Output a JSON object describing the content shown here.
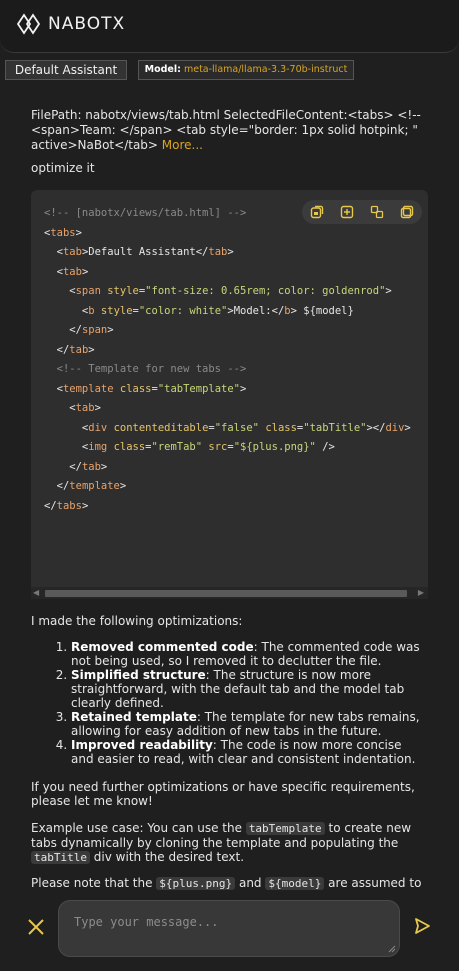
{
  "header": {
    "logo_text": "NABOTX"
  },
  "tabs": {
    "default_label": "Default Assistant",
    "model_label": "Model:",
    "model_value": "meta-llama/llama-3.3-70b-instruct"
  },
  "chat": {
    "user_message": "FilePath: nabotx/views/tab.html SelectedFileContent:<tabs> <!--<span>Team: </span> <tab style=\"border: 1px solid hotpink; \" active>NaBot</tab>",
    "more_link": "More...",
    "user_prompt": "optimize it",
    "code_lines": [
      "<!-- [nabotx/views/tab.html] -->",
      "<tabs>",
      "  <tab>Default Assistant</tab>",
      "  <tab>",
      "    <span style=\"font-size: 0.65rem; color: goldenrod\">",
      "      <b style=\"color: white\">Model:</b> ${model}",
      "    </span>",
      "  </tab>",
      "  <!-- Template for new tabs -->",
      "  <template class=\"tabTemplate\">",
      "    <tab>",
      "      <div contenteditable=\"false\" class=\"tabTitle\"></div>",
      "      <img class=\"remTab\" src=\"${plus.png}\" />",
      "    </tab>",
      "  </template>",
      "</tabs>"
    ],
    "reply_intro": "I made the following optimizations:",
    "optimizations": [
      {
        "title": "Removed commented code",
        "text": ": The commented code was not being used, so I removed it to declutter the file."
      },
      {
        "title": "Simplified structure",
        "text": ": The structure is now more straightforward, with the default tab and the model tab clearly defined."
      },
      {
        "title": "Retained template",
        "text": ": The template for new tabs remains, allowing for easy addition of new tabs in the future."
      },
      {
        "title": "Improved readability",
        "text": ": The code is now more concise and easier to read, with clear and consistent indentation."
      }
    ],
    "further": "If you need further optimizations or have specific requirements, please let me know!",
    "example_a": "Example use case: You can use the ",
    "example_code1": "tabTemplate",
    "example_b": " to create new tabs dynamically by cloning the template and populating the ",
    "example_code2": "tabTitle",
    "example_c": " div with the desired text.",
    "note_a": "Please note that the ",
    "note_code1": "${plus.png}",
    "note_b": " and ",
    "note_code2": "${model}",
    "note_c": " are assumed to be"
  },
  "footer": {
    "input_placeholder": "Type your message..."
  },
  "colors": {
    "accent": "#daa520",
    "background": "#1f1f1f",
    "code_bg": "#2e2e2e"
  }
}
